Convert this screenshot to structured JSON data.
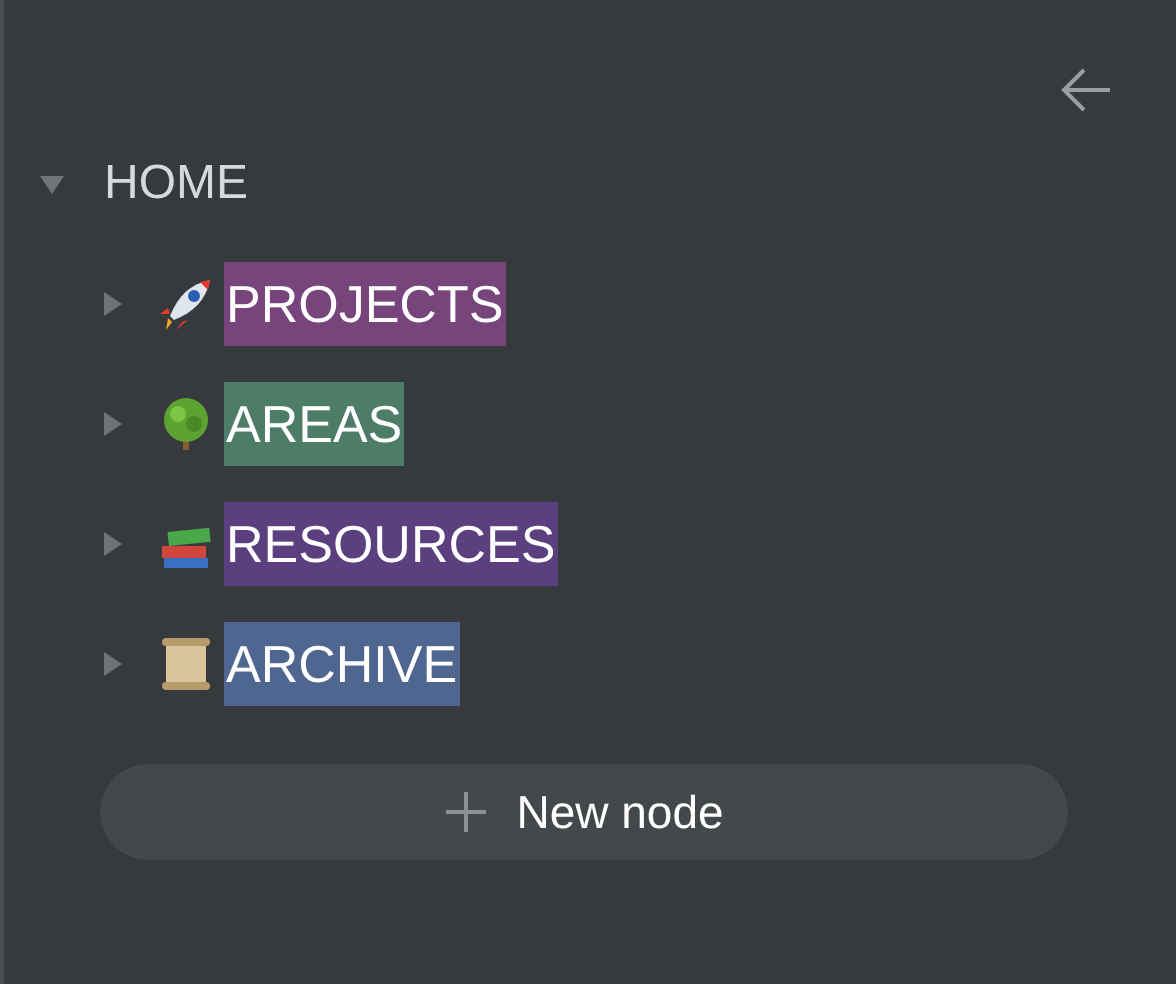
{
  "tree": {
    "label": "HOME",
    "expanded": true,
    "children": [
      {
        "label": "PROJECTS",
        "expanded": false,
        "color": "#77457c"
      },
      {
        "label": "AREAS",
        "expanded": false,
        "color": "#4d7c68"
      },
      {
        "label": "RESOURCES",
        "expanded": false,
        "color": "#5b3f7e"
      },
      {
        "label": "ARCHIVE",
        "expanded": false,
        "color": "#4f6690"
      }
    ]
  },
  "new_node_button": {
    "label": "New node"
  }
}
